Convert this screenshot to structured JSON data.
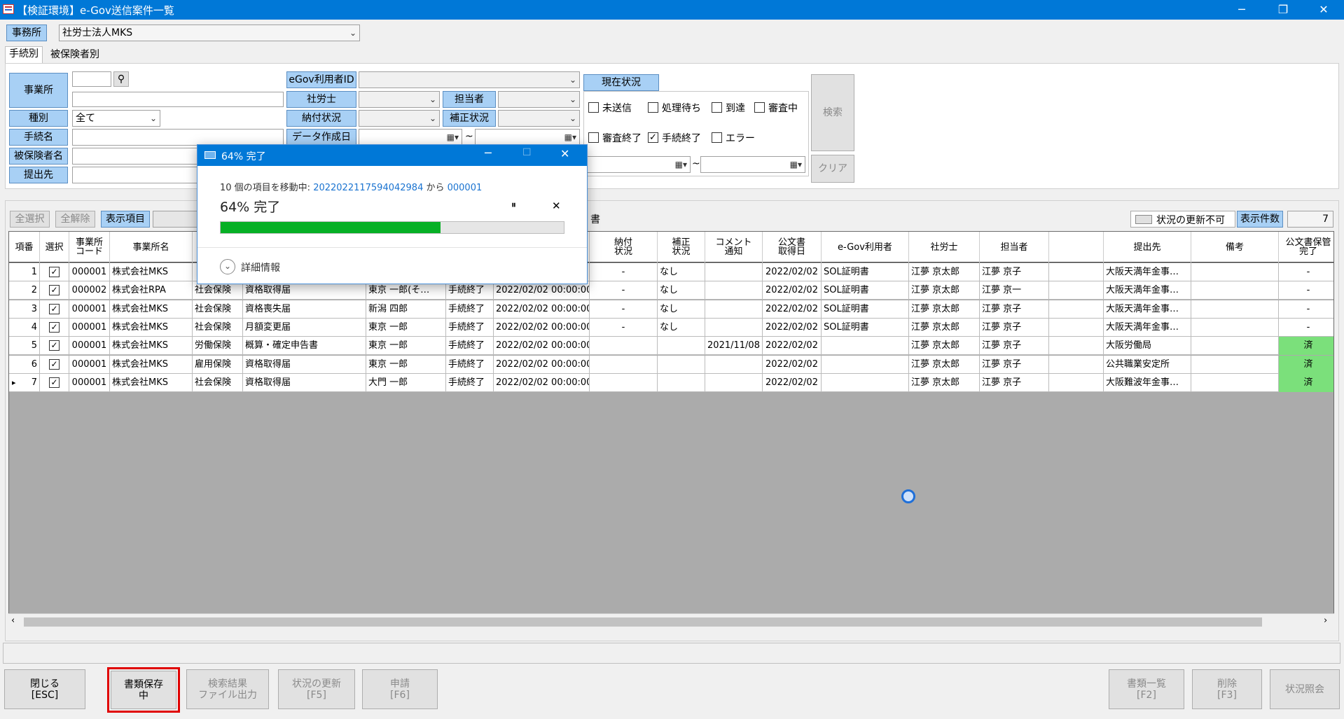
{
  "window": {
    "title": "【検証環境】e-Gov送信案件一覧",
    "minimize": "─",
    "restore": "❐",
    "close": "✕"
  },
  "office": {
    "label": "事務所",
    "value": "社労士法人MKS"
  },
  "tabs": [
    "手続別",
    "被保険者別"
  ],
  "filters": {
    "jigyosho_label": "事業所",
    "shubetsu_label": "種別",
    "shubetsu_value": "全て",
    "tetsuzuki_label": "手続名",
    "hihokensha_label": "被保険者名",
    "teishutsu_label": "提出先",
    "egov_id_label": "eGov利用者ID",
    "sharoushi_label": "社労士",
    "tantousha_label": "担当者",
    "noufu_label": "納付状況",
    "hosei_label": "補正状況",
    "data_date_label": "データ作成日",
    "tilde": "~"
  },
  "status": {
    "label": "現在状況",
    "options": [
      {
        "label": "未送信",
        "checked": false
      },
      {
        "label": "処理待ち",
        "checked": false
      },
      {
        "label": "到達",
        "checked": false
      },
      {
        "label": "審査中",
        "checked": false
      },
      {
        "label": "審査終了",
        "checked": false
      },
      {
        "label": "手続終了",
        "checked": true
      },
      {
        "label": "エラー",
        "checked": false
      }
    ]
  },
  "actions": {
    "search": "検索",
    "clear": "クリア",
    "select_all": "全選択",
    "deselect_all": "全解除",
    "display_items": "表示項目",
    "no_update_label": "状況の更新不可",
    "display_count_label": "表示件数",
    "display_count": "7",
    "partial_header": "書"
  },
  "grid": {
    "headers": [
      "項番",
      "選択",
      "事業所\nコード",
      "事業所名",
      "",
      "",
      "",
      "",
      "",
      "納付\n状況",
      "補正\n状況",
      "コメント\n通知",
      "公文書\n取得日",
      "e-Gov利用者",
      "社労士",
      "担当者",
      "",
      "提出先",
      "備考",
      "公文書保管\n完了"
    ],
    "rows": [
      {
        "no": "1",
        "code": "000001",
        "name": "株式会社MKS",
        "kind": "",
        "proc": "",
        "person": "",
        "state": "",
        "date": "",
        "noufu": "-",
        "hosei": "なし",
        "comment": "",
        "koubun": "2022/02/02",
        "egov": "SOL証明書",
        "shr": "江夢 京太郎",
        "tnt": "江夢 京子",
        "blank": "",
        "dest": "大阪天満年金事…",
        "note": "",
        "done": "-"
      },
      {
        "no": "2",
        "code": "000002",
        "name": "株式会社RPA",
        "kind": "社会保険",
        "proc": "資格取得届",
        "person": "東京 一郎(そ…",
        "state": "手続終了",
        "date": "2022/02/02 00:00:00",
        "noufu": "-",
        "hosei": "なし",
        "comment": "",
        "koubun": "2022/02/02",
        "egov": "SOL証明書",
        "shr": "江夢 京太郎",
        "tnt": "江夢 京一",
        "blank": "",
        "dest": "大阪天満年金事…",
        "note": "",
        "done": "-"
      },
      {
        "no": "3",
        "code": "000001",
        "name": "株式会社MKS",
        "kind": "社会保険",
        "proc": "資格喪失届",
        "person": "新潟 四郎",
        "state": "手続終了",
        "date": "2022/02/02 00:00:00",
        "noufu": "-",
        "hosei": "なし",
        "comment": "",
        "koubun": "2022/02/02",
        "egov": "SOL証明書",
        "shr": "江夢 京太郎",
        "tnt": "江夢 京子",
        "blank": "",
        "dest": "大阪天満年金事…",
        "note": "",
        "done": "-"
      },
      {
        "no": "4",
        "code": "000001",
        "name": "株式会社MKS",
        "kind": "社会保険",
        "proc": "月額変更届",
        "person": "東京 一郎",
        "state": "手続終了",
        "date": "2022/02/02 00:00:00",
        "noufu": "-",
        "hosei": "なし",
        "comment": "",
        "koubun": "2022/02/02",
        "egov": "SOL証明書",
        "shr": "江夢 京太郎",
        "tnt": "江夢 京子",
        "blank": "",
        "dest": "大阪天満年金事…",
        "note": "",
        "done": "-"
      },
      {
        "no": "5",
        "code": "000001",
        "name": "株式会社MKS",
        "kind": "労働保険",
        "proc": "概算・確定申告書",
        "person": "東京 一郎",
        "state": "手続終了",
        "date": "2022/02/02 00:00:00",
        "noufu": "",
        "hosei": "",
        "comment": "2021/11/08",
        "koubun": "2022/02/02",
        "egov": "",
        "shr": "江夢 京太郎",
        "tnt": "江夢 京子",
        "blank": "",
        "dest": "大阪労働局",
        "note": "",
        "done": "済"
      },
      {
        "no": "6",
        "code": "000001",
        "name": "株式会社MKS",
        "kind": "雇用保険",
        "proc": "資格取得届",
        "person": "東京 一郎",
        "state": "手続終了",
        "date": "2022/02/02 00:00:00",
        "noufu": "",
        "hosei": "",
        "comment": "",
        "koubun": "2022/02/02",
        "egov": "",
        "shr": "江夢 京太郎",
        "tnt": "江夢 京子",
        "blank": "",
        "dest": "公共職業安定所",
        "note": "",
        "done": "済"
      },
      {
        "no": "7",
        "code": "000001",
        "name": "株式会社MKS",
        "kind": "社会保険",
        "proc": "資格取得届",
        "person": "大門 一郎",
        "state": "手続終了",
        "date": "2022/02/02 00:00:00",
        "noufu": "",
        "hosei": "",
        "comment": "",
        "koubun": "2022/02/02",
        "egov": "",
        "shr": "江夢 京太郎",
        "tnt": "江夢 京子",
        "blank": "",
        "dest": "大阪難波年金事…",
        "note": "",
        "done": "済"
      }
    ]
  },
  "dialog": {
    "title": "64% 完了",
    "move_prefix": "10 個の項目を移動中: ",
    "source": "20220221175940429​84",
    "from": " から ",
    "dest": "000001",
    "percent_text": "64% 完了",
    "progress": 64,
    "details": "詳細情報",
    "pause": "⏸",
    "cancel": "✕"
  },
  "bottom": {
    "close": "閉じる\n[ESC]",
    "save": "書類保存\n中",
    "export": "検索結果\nファイル出力",
    "update": "状況の更新\n[F5]",
    "apply": "申請\n[F6]",
    "doclist": "書類一覧\n[F2]",
    "delete": "削除\n[F3]",
    "inquiry": "状況照会"
  },
  "colors": {
    "titlebar": "#0078d7",
    "label_bg": "#a8d0f5",
    "done_bg": "#7be07b",
    "progress": "#06b025",
    "highlight": "#e00000"
  }
}
